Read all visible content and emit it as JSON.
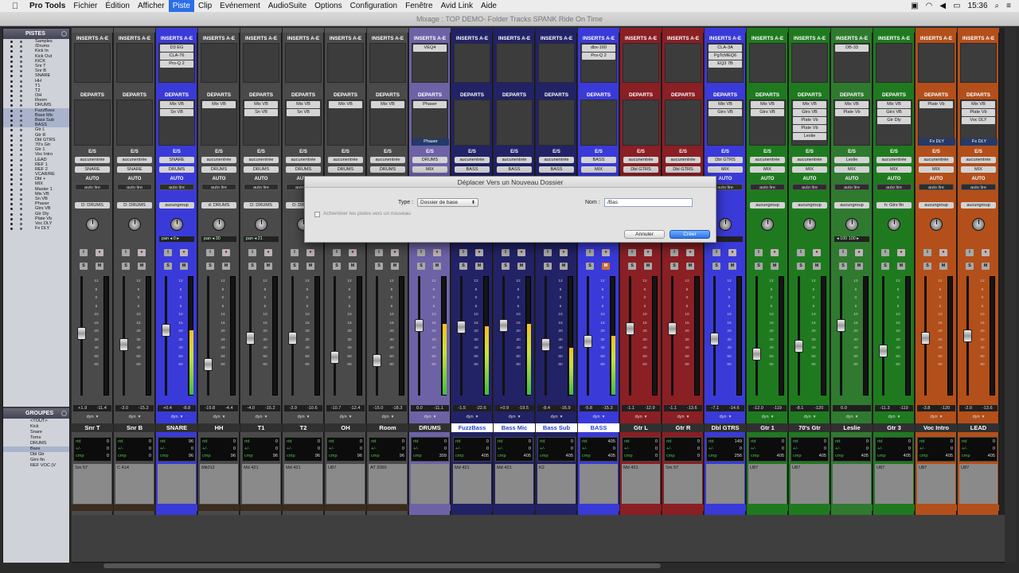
{
  "menubar": {
    "app": "Pro Tools",
    "items": [
      "Fichier",
      "Édition",
      "Afficher",
      "Piste",
      "Clip",
      "Evénement",
      "AudioSuite",
      "Options",
      "Configuration",
      "Fenêtre",
      "Avid Link",
      "Aide"
    ],
    "active": "Piste",
    "clock": "15:36"
  },
  "window": {
    "title": "Mixage : TOP DEMO- Folder Tracks SPANK Ride On Time"
  },
  "tracks_panel": {
    "header": "PISTES",
    "items": [
      "Samples",
      "/Drums",
      "Kick In",
      "Kick Out",
      "KICK",
      "Snr T",
      "Snr B",
      "SNARE",
      "HH",
      "T1",
      "T2",
      "OH",
      "Room",
      "DRUMS",
      "FuzzBass",
      "Bass Mic",
      "Bass Sub",
      "BASS",
      "Gtr L",
      "Gtr R",
      "Dbl GTRS",
      "70's Gtr",
      "Gtr 1",
      "Voc Intro",
      "LEAD",
      "REF 1",
      "REF 2",
      "VCAR/RE",
      "Dbl +",
      "MIX",
      "Master 1",
      "Mix VB",
      "Sn VB",
      "Phaser",
      "Gtrs VB",
      "Gtr Dly",
      "Plate Vb",
      "Voc DLY",
      "Fx DLY"
    ],
    "selected": [
      "FuzzBass",
      "Bass Mic",
      "Bass Sub",
      "BASS"
    ]
  },
  "groups_panel": {
    "header": "GROUPES",
    "items": [
      "<TOUT>",
      "Kick",
      "Snare",
      "Toms",
      "DRUMS",
      "Bass",
      "Dbl Gtr",
      "Gtrs fin",
      "REF VOC (V"
    ],
    "selected": "Bass"
  },
  "labels": {
    "inserts": "INSERTS A-E",
    "departs": "DEPARTS",
    "es": "E/S",
    "auto": "AUTO",
    "dyn": "dyn",
    "pan": "pan",
    "rtd": "rtd",
    "pm": "+/-",
    "cmp": "cmp"
  },
  "strips": [
    {
      "name": "Snr T",
      "color": "#4a4a4a",
      "inserts": [],
      "sends": [],
      "input": "aucunentrée",
      "output": "SNARE",
      "auto": "auto lire",
      "group": "D: DRUMS",
      "pan": "",
      "v1": "+1.9",
      "v2": "-11.4",
      "fader": 0.52,
      "meter": 0.0,
      "dly": [
        "0",
        "0",
        "0"
      ],
      "comment": "Sm 57",
      "mute": false
    },
    {
      "name": "Snr B",
      "color": "#4a4a4a",
      "inserts": [],
      "sends": [],
      "input": "aucunentrée",
      "output": "SNARE",
      "auto": "auto lire",
      "group": "D: DRUMS",
      "pan": "",
      "v1": "-3.0",
      "v2": "-15.2",
      "fader": 0.42,
      "meter": 0.0,
      "dly": [
        "0",
        "0",
        "0"
      ],
      "comment": "C 414",
      "mute": false
    },
    {
      "name": "SNARE",
      "color": "#3a3ad8",
      "inserts": [
        "D3 EG",
        "CLA-76",
        "Pro-Q 2"
      ],
      "sends": [
        "Mix VB",
        "Sn VB"
      ],
      "input": "SNARE",
      "output": "DRUMS",
      "auto": "auto lire",
      "group": "aucungroup",
      "pan": "pan ◂ 0 ▸",
      "v1": "+0.4",
      "v2": "-8.8",
      "fader": 0.55,
      "meter": 0.55,
      "dly": [
        "96",
        "0",
        "96"
      ],
      "comment": "",
      "mute": false
    },
    {
      "name": "HH",
      "color": "#4a4a4a",
      "inserts": [],
      "sends": [
        "Mix VB"
      ],
      "input": "aucunentrée",
      "output": "DRUMS",
      "auto": "auto lire",
      "group": "d: DRUMS",
      "pan": "pan ◂ 30",
      "v1": "-19.8",
      "v2": "-4.4",
      "fader": 0.23,
      "meter": 0.0,
      "dly": [
        "0",
        "0",
        "96"
      ],
      "comment": "Mk012",
      "mute": false
    },
    {
      "name": "T1",
      "color": "#4a4a4a",
      "inserts": [],
      "sends": [
        "Mix VB",
        "Sn VB"
      ],
      "input": "aucunentrée",
      "output": "DRUMS",
      "auto": "auto lire",
      "group": "D: DRUMS",
      "pan": "pan ◂ 21",
      "v1": "-4.0",
      "v2": "-15.2",
      "fader": 0.48,
      "meter": 0.0,
      "dly": [
        "0",
        "0",
        "96"
      ],
      "comment": "Md 421",
      "mute": false
    },
    {
      "name": "T2",
      "color": "#4a4a4a",
      "inserts": [],
      "sends": [
        "Mix VB",
        "Sn VB"
      ],
      "input": "aucunentrée",
      "output": "DRUMS",
      "auto": "auto lire",
      "group": "D: DRUMS",
      "pan": "",
      "v1": "-3.9",
      "v2": "-10.6",
      "fader": 0.48,
      "meter": 0.0,
      "dly": [
        "0",
        "0",
        "96"
      ],
      "comment": "Md 421",
      "mute": false
    },
    {
      "name": "OH",
      "color": "#4a4a4a",
      "inserts": [],
      "sends": [
        "Mix VB"
      ],
      "input": "aucunentrée",
      "output": "DRUMS",
      "auto": "auto lire",
      "group": "D: DRUMS",
      "pan": "",
      "v1": "-10.7",
      "v2": "-12.4",
      "fader": 0.3,
      "meter": 0.0,
      "dly": [
        "0",
        "0",
        "96"
      ],
      "comment": "U87",
      "mute": false
    },
    {
      "name": "Room",
      "color": "#4a4a4a",
      "inserts": [],
      "sends": [
        "Mix VB"
      ],
      "input": "aucunentrée",
      "output": "DRUMS",
      "auto": "auto lire",
      "group": "D: DRUMS",
      "pan": "",
      "v1": "-15.0",
      "v2": "-18.3",
      "fader": 0.27,
      "meter": 0.0,
      "dly": [
        "0",
        "0",
        "96"
      ],
      "comment": "AT 2050",
      "mute": false
    },
    {
      "name": "DRUMS",
      "color": "#6d62a6",
      "inserts": [
        "VEQ4"
      ],
      "sends": [
        "Phaser"
      ],
      "input": "DRUMS",
      "output": "MIX",
      "auto": "auto lire",
      "group": "",
      "pan": "",
      "v1": "0.0",
      "v2": "-11.1",
      "fader": 0.6,
      "meter": 0.6,
      "dly": [
        "0",
        "0",
        "309"
      ],
      "comment": "",
      "mute": false
    },
    {
      "name": "FuzzBass",
      "color": "#222266",
      "inserts": [],
      "sends": [],
      "input": "aucunentrée",
      "output": "BASS",
      "auto": "auto lire",
      "group": "",
      "pan": "",
      "v1": "-1.5",
      "v2": "-22.6",
      "fader": 0.58,
      "meter": 0.58,
      "dly": [
        "0",
        "0",
        "405"
      ],
      "comment": "Md 421",
      "mute": false,
      "hl": true
    },
    {
      "name": "Bass Mic",
      "color": "#222266",
      "inserts": [],
      "sends": [],
      "input": "aucunentrée",
      "output": "BASS",
      "auto": "auto lire",
      "group": "",
      "pan": "",
      "v1": "+0.9",
      "v2": "-19.5",
      "fader": 0.6,
      "meter": 0.6,
      "dly": [
        "0",
        "0",
        "405"
      ],
      "comment": "Md 421",
      "mute": false,
      "hl": true
    },
    {
      "name": "Bass Sub",
      "color": "#222266",
      "inserts": [],
      "sends": [],
      "input": "aucunentrée",
      "output": "BASS",
      "auto": "auto lire",
      "group": "",
      "pan": "",
      "v1": "-8.4",
      "v2": "-16.9",
      "fader": 0.42,
      "meter": 0.4,
      "dly": [
        "0",
        "0",
        "405"
      ],
      "comment": "K2",
      "mute": false,
      "hl": true
    },
    {
      "name": "BASS",
      "color": "#3a3ad8",
      "inserts": [
        "dbx-160",
        "Pro-Q 2"
      ],
      "sends": [],
      "input": "BASS",
      "output": "MIX",
      "auto": "auto lire",
      "group": "",
      "pan": "",
      "v1": "-5.8",
      "v2": "-15.3",
      "fader": 0.45,
      "meter": 0.5,
      "dly": [
        "405",
        "0",
        "405"
      ],
      "comment": "",
      "mute": true,
      "hl": true
    },
    {
      "name": "Gtr L",
      "color": "#8a1f24",
      "inserts": [],
      "sends": [],
      "input": "aucunentrée",
      "output": "Dbl GTRS",
      "auto": "auto lire",
      "group": "aucungroup",
      "pan": "",
      "v1": "-1.1",
      "v2": "-12.9",
      "fader": 0.57,
      "meter": 0.0,
      "dly": [
        "0",
        "0",
        "0"
      ],
      "comment": "Md 421",
      "mute": false
    },
    {
      "name": "Gtr R",
      "color": "#8a1f24",
      "inserts": [],
      "sends": [],
      "input": "aucunentrée",
      "output": "Dbl GTRS",
      "auto": "auto lire",
      "group": "",
      "pan": "",
      "v1": "-1.1",
      "v2": "-13.6",
      "fader": 0.57,
      "meter": 0.0,
      "dly": [
        "0",
        "0",
        "0"
      ],
      "comment": "Sm 57",
      "mute": false
    },
    {
      "name": "Dbl GTRS",
      "color": "#3a3ad8",
      "inserts": [
        "CLA-3A",
        "PgTcMEQ6",
        "EQ3 7B"
      ],
      "sends": [
        "Mix VB",
        "Gtrs VB"
      ],
      "input": "Dbl GTRS",
      "output": "MIX",
      "auto": "auto lire",
      "group": "",
      "pan": "80",
      "v1": "-7.1",
      "v2": "-14.6",
      "fader": 0.47,
      "meter": 0.0,
      "dly": [
        "149",
        "0",
        "256"
      ],
      "comment": "",
      "mute": false
    },
    {
      "name": "Gtr 1",
      "color": "#1f7a1f",
      "inserts": [],
      "sends": [
        "Mix VB",
        "Gtrs VB"
      ],
      "input": "aucunentrée",
      "output": "MIX",
      "auto": "auto lire",
      "group": "aucungroup",
      "pan": "",
      "v1": "-12.0",
      "v2": "-119",
      "fader": 0.33,
      "meter": 0.0,
      "dly": [
        "0",
        "0",
        "405"
      ],
      "comment": "U87",
      "mute": false
    },
    {
      "name": "70's Gtr",
      "color": "#1f7a1f",
      "inserts": [],
      "sends": [
        "Mix VB",
        "Gtrs VB",
        "Plate Vb",
        "Plate Vb",
        "Leslie"
      ],
      "input": "aucunentrée",
      "output": "MIX",
      "auto": "auto lire",
      "group": "aucungroup",
      "pan": "",
      "v1": "-8.1",
      "v2": "-120",
      "fader": 0.4,
      "meter": 0.0,
      "dly": [
        "0",
        "0",
        "405"
      ],
      "comment": "U87",
      "mute": false
    },
    {
      "name": "Leslie",
      "color": "#2f7a2f",
      "inserts": [
        "DB-33"
      ],
      "sends": [
        "Mix VB",
        "Plate Vb"
      ],
      "input": "Leslie",
      "output": "MIX",
      "auto": "auto lire",
      "group": "aucungroup",
      "pan": "◂ 100 100 ▸",
      "v1": "0.0",
      "v2": "",
      "fader": 0.6,
      "meter": 0.0,
      "dly": [
        "0",
        "0",
        "405"
      ],
      "comment": "",
      "mute": false
    },
    {
      "name": "Gtr 3",
      "color": "#1f7a1f",
      "inserts": [],
      "sends": [
        "Mix VB",
        "Gtrs VB",
        "Gtr Dly"
      ],
      "input": "aucunentrée",
      "output": "MIX",
      "auto": "auto lire",
      "group": "h: Gtrs fin",
      "pan": "",
      "v1": "-11.3",
      "v2": "-119",
      "fader": 0.36,
      "meter": 0.0,
      "dly": [
        "0",
        "0",
        "405"
      ],
      "comment": "U87",
      "mute": false
    },
    {
      "name": "Voc Intro",
      "color": "#b34f1a",
      "inserts": [],
      "sends": [
        "Plate Vb"
      ],
      "input": "aucunentrée",
      "output": "MIX",
      "auto": "auto lire",
      "group": "aucungroup",
      "pan": "",
      "v1": "-3.8",
      "v2": "-120",
      "fader": 0.48,
      "meter": 0.0,
      "dly": [
        "0",
        "0",
        "405"
      ],
      "comment": "U87",
      "mute": false
    },
    {
      "name": "LEAD",
      "color": "#b34f1a",
      "inserts": [],
      "sends": [
        "Mix VB",
        "Plate Vb",
        "Voc DLY"
      ],
      "input": "aucunentrée",
      "output": "MIX",
      "auto": "auto lire",
      "group": "aucungroup",
      "pan": "",
      "v1": "-2.0",
      "v2": "-13.6",
      "fader": 0.5,
      "meter": 0.0,
      "dly": [
        "0",
        "0",
        "405"
      ],
      "comment": "U87",
      "mute": false
    }
  ],
  "sends_extra": {
    "DRUMS": "Phaser",
    "Voc Intro": "Fx DLY",
    "LEAD": "Fx DLY"
  },
  "dialog": {
    "title": "Déplacer Vers un Nouveau Dossier",
    "type_label": "Type :",
    "type_value": "Dossier de base",
    "name_label": "Nom :",
    "name_value": "/Bas",
    "checkbox_label": "Acheminer les pistes vers un nouveau",
    "cancel": "Annuler",
    "ok": "Créer"
  },
  "scale": [
    "12",
    "6",
    "0",
    "5",
    "10",
    "15",
    "20",
    "30",
    "40",
    "50",
    "60"
  ]
}
